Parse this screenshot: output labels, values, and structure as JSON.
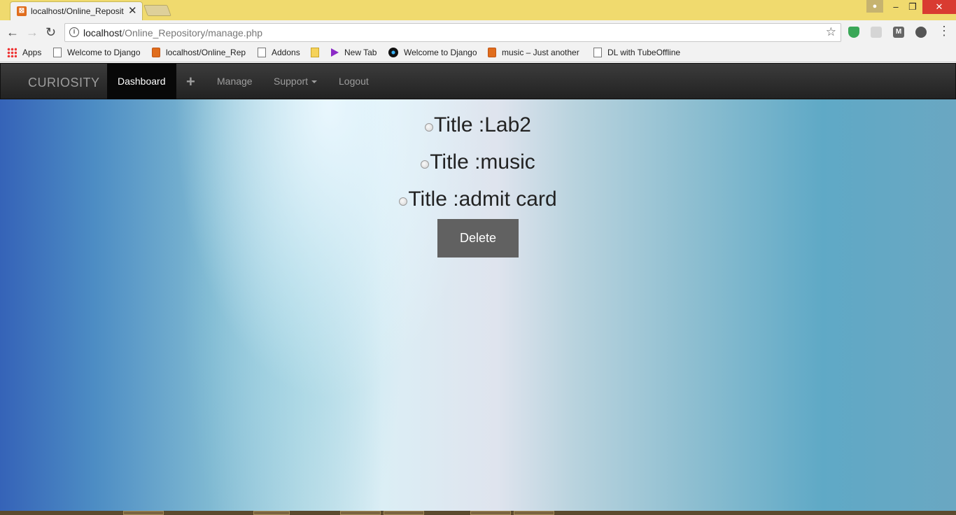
{
  "browser": {
    "tab_title": "localhost/Online_Reposit",
    "url_host": "localhost",
    "url_path": "/Online_Repository/manage.php",
    "bookmarks": [
      {
        "label": "Apps",
        "icon": "apps-icon"
      },
      {
        "label": "Welcome to Django",
        "icon": "page-icon"
      },
      {
        "label": "localhost/Online_Rep",
        "icon": "xampp-icon"
      },
      {
        "label": "Addons",
        "icon": "page-icon"
      },
      {
        "label": "",
        "icon": "folder-icon"
      },
      {
        "label": "New Tab",
        "icon": "play-icon"
      },
      {
        "label": "Welcome to Django",
        "icon": "disc-icon"
      },
      {
        "label": "music – Just another",
        "icon": "xampp-icon"
      },
      {
        "label": "DL with TubeOffline",
        "icon": "page-icon"
      }
    ]
  },
  "navbar": {
    "brand": "CURIOSITY",
    "dashboard": "Dashboard",
    "plus": "+",
    "manage": "Manage",
    "support": "Support",
    "logout": "Logout"
  },
  "entries": [
    {
      "label": "Title :Lab2"
    },
    {
      "label": "Title :music"
    },
    {
      "label": "Title :admit card"
    }
  ],
  "delete_label": "Delete",
  "colors": {
    "navbar": "#222222",
    "active_nav": "#080808",
    "delete_button": "#616161",
    "tabstrip": "#f0da6e"
  }
}
